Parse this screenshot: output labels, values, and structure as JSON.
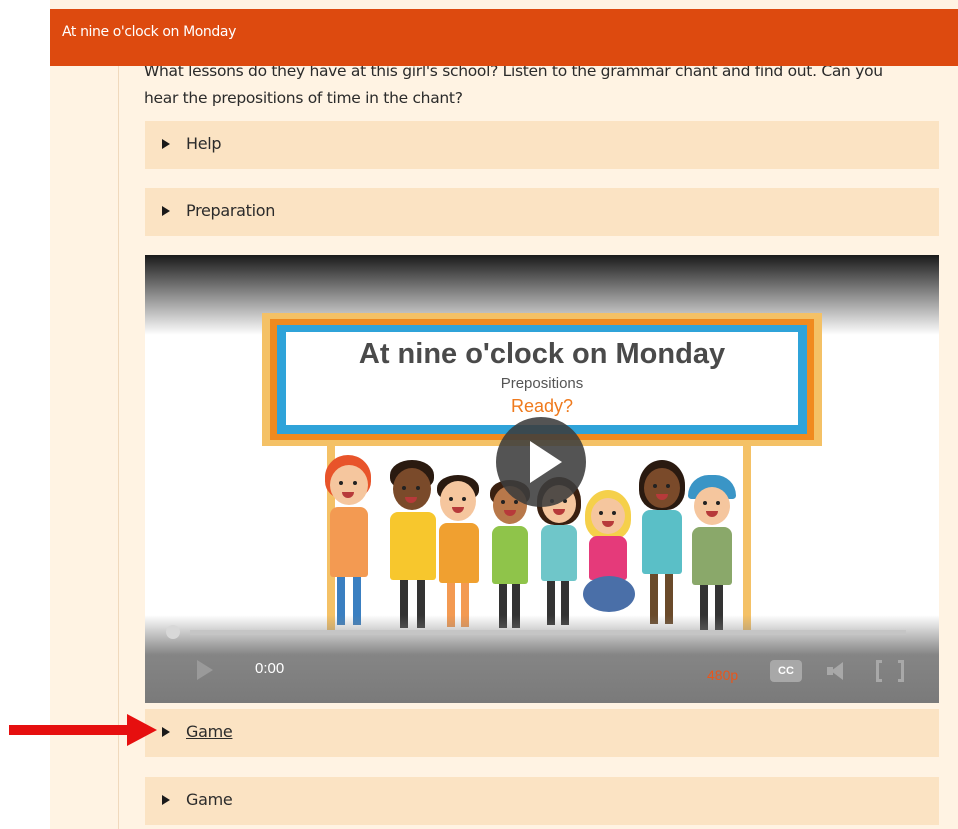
{
  "page": {
    "title": "At nine o'clock on Monday",
    "intro_line1": "What lessons do they have at this girl's school? Listen to the grammar chant and find out. Can you",
    "intro_line2": "hear the prepositions of time in the chant?"
  },
  "accordions": {
    "help": "Help",
    "preparation": "Preparation",
    "game1": "Game",
    "game2": "Game"
  },
  "video": {
    "board_title": "At nine o'clock on Monday",
    "board_subtitle": "Prepositions",
    "board_prompt": "Ready?",
    "time": "0:00",
    "quality": "480p",
    "cc_label": "CC"
  },
  "icons": {
    "accordion": "triangle-right-icon",
    "play": "play-icon",
    "volume": "volume-icon",
    "fullscreen": "fullscreen-icon",
    "annotation": "red-arrow-icon"
  },
  "colors": {
    "title_bar": "#dd4a0f",
    "page_bg": "#fff3e3",
    "accordion_bg": "#fbe3c3",
    "quality_text": "#e8561b",
    "arrow": "#e60f0f"
  }
}
